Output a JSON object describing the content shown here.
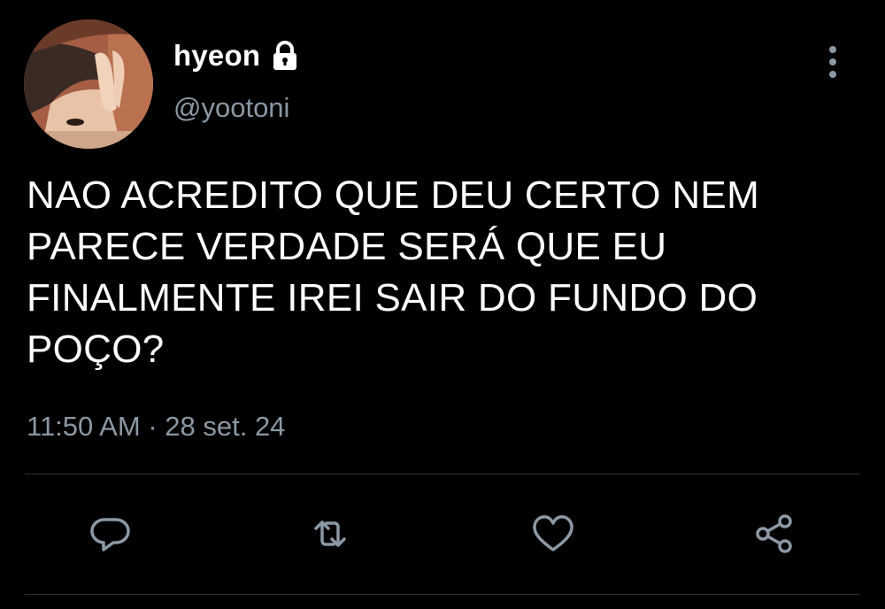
{
  "author": {
    "display_name": "hyeon",
    "handle": "@yootoni",
    "protected_icon": "lock-icon",
    "avatar": "profile-photo"
  },
  "tweet": {
    "text": "NAO ACREDITO QUE DEU CERTO NEM\nPARECE VERDADE SERÁ QUE EU\nFINALMENTE IREI SAIR DO FUNDO DO\nPOÇO?",
    "time": "11:50 AM",
    "separator": "·",
    "date": "28 set. 24"
  },
  "actions": {
    "reply_icon": "reply-icon",
    "retweet_icon": "retweet-icon",
    "like_icon": "heart-icon",
    "share_icon": "share-icon",
    "more_icon": "more-vertical-icon"
  },
  "colors": {
    "background": "#000000",
    "primary_text": "#ffffff",
    "secondary_text": "#8b98a5",
    "divider": "#2f3336"
  }
}
